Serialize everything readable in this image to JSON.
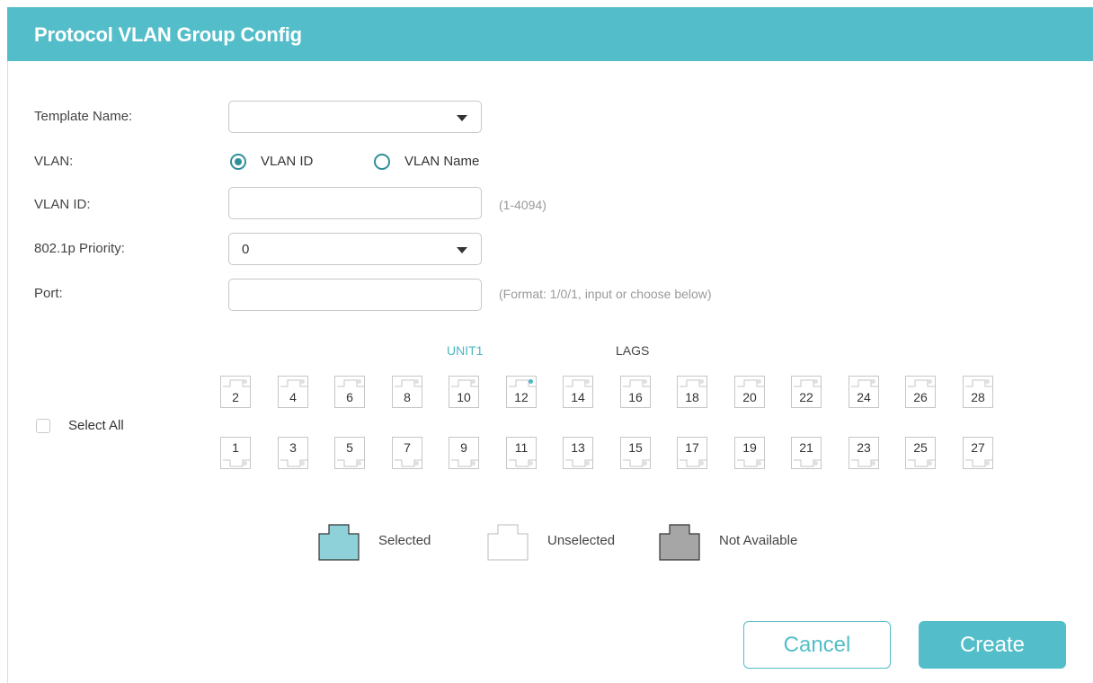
{
  "header": {
    "title": "Protocol VLAN Group Config"
  },
  "form": {
    "template_name": {
      "label": "Template Name:",
      "value": ""
    },
    "vlan": {
      "label": "VLAN:",
      "options": [
        {
          "label": "VLAN ID",
          "checked": true
        },
        {
          "label": "VLAN Name",
          "checked": false
        }
      ]
    },
    "vlan_id": {
      "label": "VLAN ID:",
      "value": "",
      "hint": "(1-4094)"
    },
    "priority": {
      "label": "802.1p Priority:",
      "value": "0"
    },
    "port": {
      "label": "Port:",
      "value": "",
      "hint": "(Format: 1/0/1, input or choose below)"
    }
  },
  "port_panel": {
    "tabs": [
      {
        "label": "UNIT1",
        "active": true
      },
      {
        "label": "LAGS",
        "active": false
      }
    ],
    "select_all_label": "Select All",
    "top_row": [
      "2",
      "4",
      "6",
      "8",
      "10",
      "12",
      "14",
      "16",
      "18",
      "20",
      "22",
      "24",
      "26",
      "28"
    ],
    "bottom_row": [
      "1",
      "3",
      "5",
      "7",
      "9",
      "11",
      "13",
      "15",
      "17",
      "19",
      "21",
      "23",
      "25",
      "27"
    ],
    "link_up_ports": [
      "12"
    ],
    "legend": [
      {
        "label": "Selected",
        "color": "#8fd1d8"
      },
      {
        "label": "Unselected",
        "color": "#ffffff"
      },
      {
        "label": "Not Available",
        "color": "#a6a6a6"
      }
    ]
  },
  "buttons": {
    "cancel": "Cancel",
    "create": "Create"
  }
}
